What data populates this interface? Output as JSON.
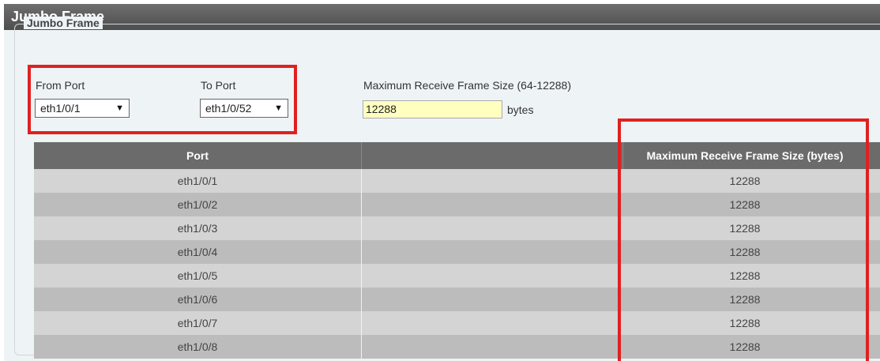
{
  "header": {
    "title": "Jumbo Frame"
  },
  "form": {
    "legend": "Jumbo Frame",
    "from_port": {
      "label": "From Port",
      "value": "eth1/0/1"
    },
    "to_port": {
      "label": "To Port",
      "value": "eth1/0/52"
    },
    "max_frame": {
      "label": "Maximum Receive Frame Size (64-12288)",
      "value": "12288",
      "unit": "bytes"
    }
  },
  "table": {
    "columns": [
      "Port",
      "",
      "Maximum Receive Frame Size (bytes)"
    ],
    "rows": [
      {
        "port": "eth1/0/1",
        "size": "12288"
      },
      {
        "port": "eth1/0/2",
        "size": "12288"
      },
      {
        "port": "eth1/0/3",
        "size": "12288"
      },
      {
        "port": "eth1/0/4",
        "size": "12288"
      },
      {
        "port": "eth1/0/5",
        "size": "12288"
      },
      {
        "port": "eth1/0/6",
        "size": "12288"
      },
      {
        "port": "eth1/0/7",
        "size": "12288"
      },
      {
        "port": "eth1/0/8",
        "size": "12288"
      }
    ]
  },
  "highlight_color": "#e02020",
  "icons": {
    "dropdown": "chevron-down-icon"
  }
}
